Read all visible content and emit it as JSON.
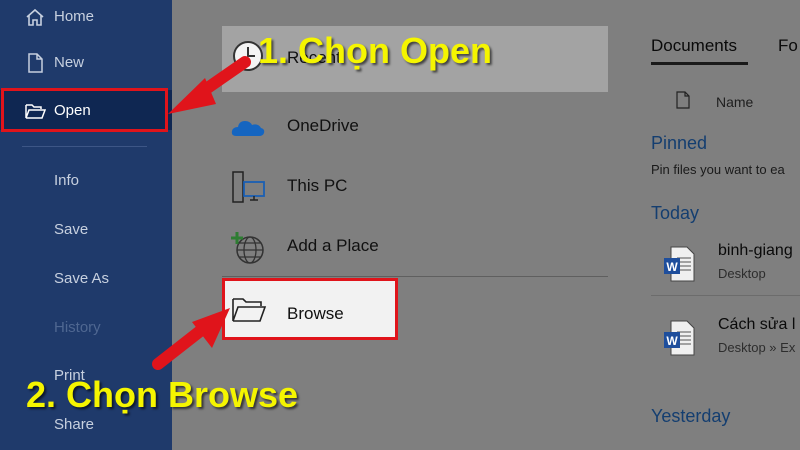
{
  "nav": {
    "home": "Home",
    "new": "New",
    "open": "Open",
    "info": "Info",
    "save": "Save",
    "save_as": "Save As",
    "history": "History",
    "print": "Print",
    "share": "Share"
  },
  "locations": {
    "recent": "Recent",
    "onedrive": "OneDrive",
    "this_pc": "This PC",
    "add_place": "Add a Place",
    "browse": "Browse"
  },
  "right": {
    "tab_documents": "Documents",
    "tab_folders": "Fo",
    "name_header": "Name",
    "pinned": "Pinned",
    "pin_hint": "Pin files you want to ea",
    "today": "Today",
    "yesterday": "Yesterday",
    "docs": [
      {
        "title": "binh-giang",
        "subtitle": "Desktop"
      },
      {
        "title": "Cách sửa l",
        "subtitle": "Desktop » Ex"
      }
    ]
  },
  "callouts": {
    "step1": "1. Chọn Open",
    "step2": "2. Chọn Browse"
  },
  "colors": {
    "nav_bg": "#1f3a6b",
    "nav_active": "#0f2752",
    "highlight": "#e0141b",
    "callout": "#f5f500",
    "section_blue": "#143e70"
  }
}
